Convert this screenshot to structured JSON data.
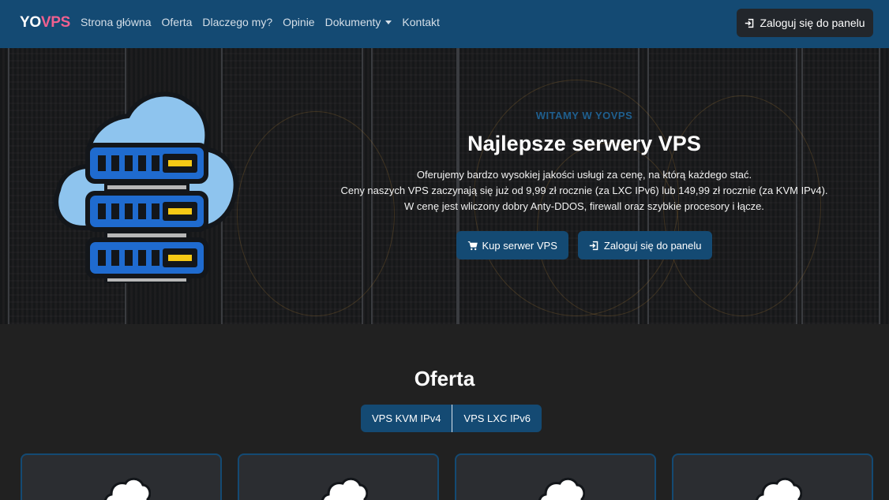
{
  "brand": {
    "part1": "YO",
    "part2": "VPS"
  },
  "nav": {
    "items": [
      {
        "label": "Strona główna"
      },
      {
        "label": "Oferta"
      },
      {
        "label": "Dlaczego my?"
      },
      {
        "label": "Opinie"
      },
      {
        "label": "Dokumenty",
        "has_dropdown": true
      },
      {
        "label": "Kontakt"
      }
    ],
    "login_button": {
      "label": "Zaloguj się do panelu",
      "icon": "login-icon"
    }
  },
  "hero": {
    "eyebrow": "WITAMY W YOVPS",
    "title": "Najlepsze serwery VPS",
    "lines": [
      "Oferujemy bardzo wysokiej jakości usługi za cenę, na którą każdego stać.",
      "Ceny naszych VPS zaczynają się już od 9,99 zł rocznie (za LXC IPv6) lub 149,99 zł rocznie (za KVM IPv4).",
      "W cenę jest wliczony dobry Anty-DDOS, firewall oraz szybkie procesory i łącze."
    ],
    "buy_button": {
      "label": "Kup serwer VPS",
      "icon": "cart-icon"
    },
    "login_button": {
      "label": "Zaloguj się do panelu",
      "icon": "login-icon"
    }
  },
  "offer": {
    "title": "Oferta",
    "tabs": [
      {
        "label": "VPS KVM IPv4"
      },
      {
        "label": "VPS LXC IPv6"
      }
    ]
  },
  "colors": {
    "navbar": "#144a73",
    "brand_accent": "#f0608f",
    "button_dark": "#22262b",
    "page_background": "#212121",
    "card_border": "#144a73"
  }
}
